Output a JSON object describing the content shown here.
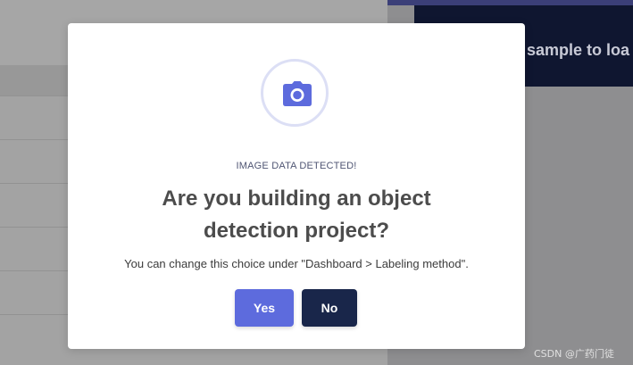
{
  "background": {
    "right_card_text": "sample to loa"
  },
  "modal": {
    "icon": "camera-icon",
    "eyebrow": "IMAGE DATA DETECTED!",
    "title": "Are you building an object detection project?",
    "subtitle": "You can change this choice under \"Dashboard > Labeling method\".",
    "yes_label": "Yes",
    "no_label": "No"
  },
  "colors": {
    "accent": "#5d6bdd",
    "dark_button": "#19264a",
    "icon_ring": "#dcdff5"
  },
  "watermark": "CSDN @广药门徒"
}
